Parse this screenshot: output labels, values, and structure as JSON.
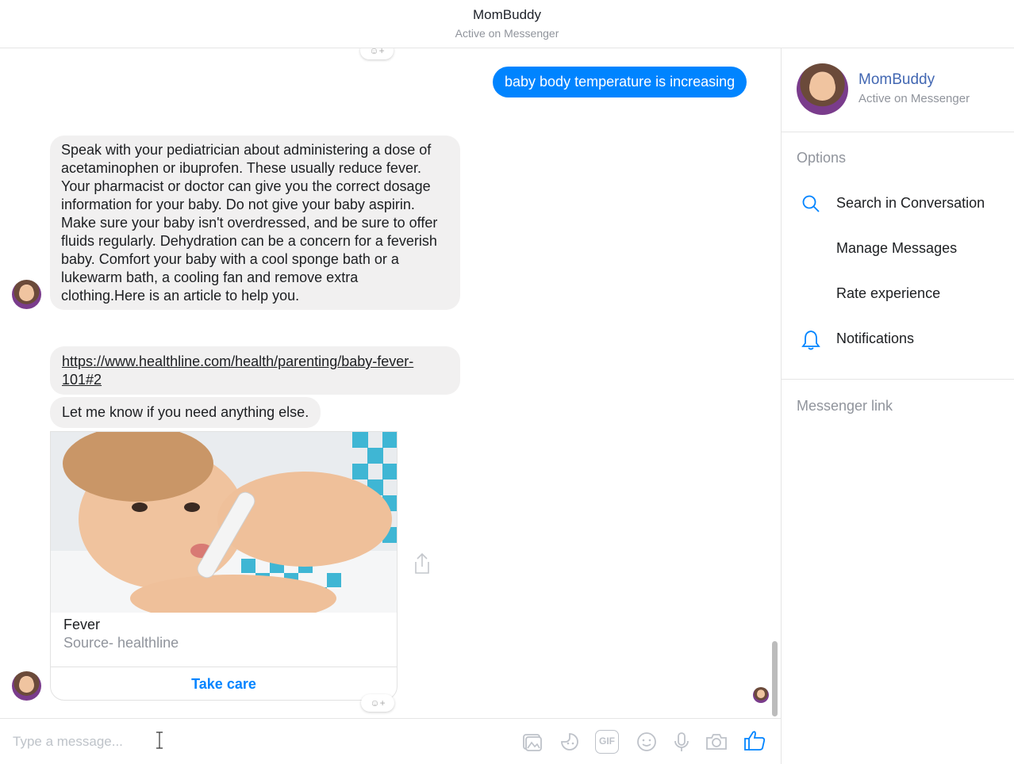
{
  "header": {
    "title": "MomBuddy",
    "subtitle": "Active on Messenger"
  },
  "messages": {
    "user_message": "baby body temperature is increasing",
    "bot_long": "Speak with your pediatrician about administering a dose of\nacetaminophen or ibuprofen. These usually reduce fever.\nYour pharmacist or doctor can give you the correct dosage\ninformation for your baby. Do not give your baby aspirin.\nMake sure your baby isn't overdressed, and be sure to offer\nfluids regularly. Dehydration can be a concern for a feverish\nbaby. Comfort your baby with a cool sponge bath or a\nlukewarm bath, a cooling fan and remove extra\nclothing.Here is an article to help you.",
    "bot_link": "https://www.healthline.com/health/parenting/baby-fever-101#2",
    "bot_short": "Let me know if you need anything else."
  },
  "card": {
    "title": "Fever",
    "subtitle": "Source- healthline",
    "button_label": "Take care"
  },
  "composer": {
    "placeholder": "Type a message...",
    "gif_label": "GIF"
  },
  "right_panel": {
    "name": "MomBuddy",
    "status": "Active on Messenger",
    "options_heading": "Options",
    "items": [
      {
        "label": "Search in Conversation",
        "icon": "search-icon"
      },
      {
        "label": "Manage Messages",
        "icon": ""
      },
      {
        "label": "Rate experience",
        "icon": ""
      },
      {
        "label": "Notifications",
        "icon": "bell-icon"
      }
    ],
    "messenger_link_heading": "Messenger link"
  },
  "colors": {
    "accent": "#0084ff",
    "brand_name": "#4267b2",
    "bubble_gray": "#f1f0f0",
    "muted_text": "#90949c"
  }
}
